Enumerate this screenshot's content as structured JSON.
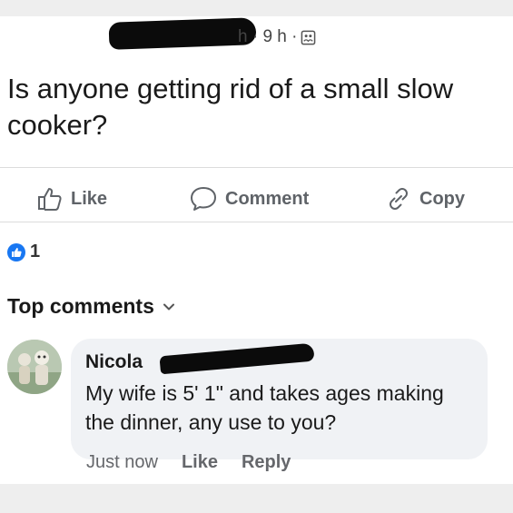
{
  "post": {
    "meta": "h · 9 h ·",
    "text": "Is anyone getting rid of a small slow cooker?",
    "icon": "globe-icon"
  },
  "actions": {
    "like_label": "Like",
    "comment_label": "Comment",
    "copy_label": "Copy"
  },
  "reactions": {
    "count": "1",
    "icon": "like-icon",
    "color": "#1877f2"
  },
  "comments": {
    "header": "Top comments",
    "items": [
      {
        "author": "Nicola",
        "text": "My wife  is 5' 1\" and takes ages making the dinner, any use to you?",
        "timestamp": "Just now",
        "like_label": "Like",
        "reply_label": "Reply"
      }
    ]
  }
}
